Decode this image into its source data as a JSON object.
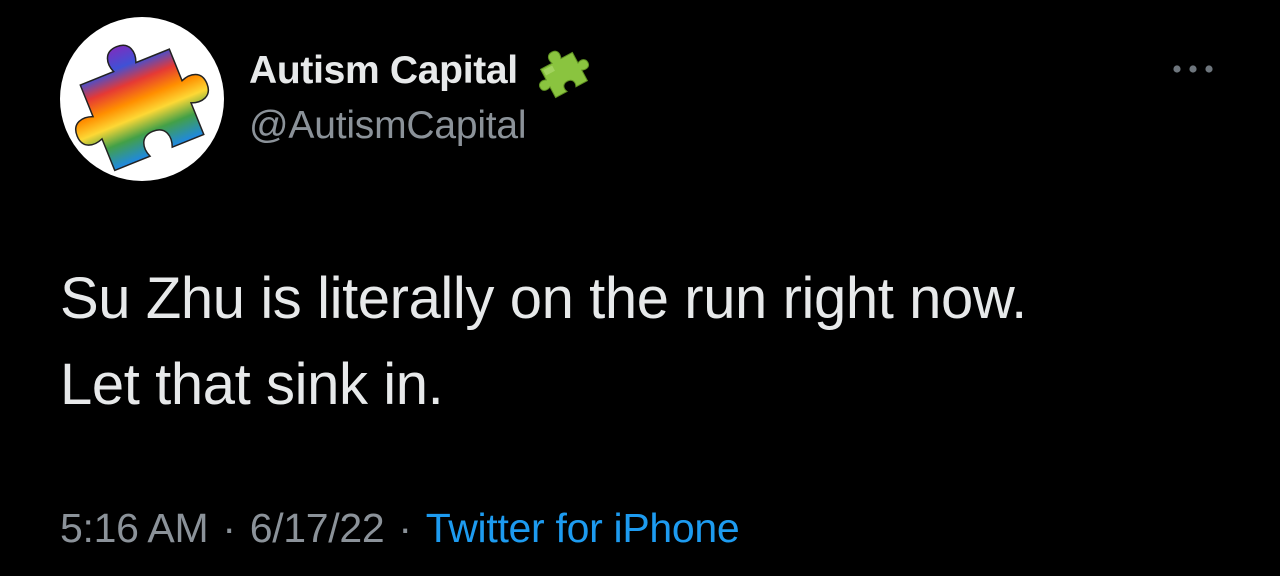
{
  "tweet": {
    "author": {
      "display_name": "Autism Capital",
      "handle": "@AutismCapital",
      "avatar_icon": "rainbow-puzzle-piece-icon",
      "badge_icon": "puzzle-piece-badge-icon"
    },
    "more_icon": "more-options-icon",
    "text_lines": [
      "Su Zhu is literally on the run right now.",
      "Let that sink in."
    ],
    "time": "5:16 AM",
    "separator": "·",
    "date": "6/17/22",
    "source": "Twitter for iPhone"
  },
  "colors": {
    "background": "#000000",
    "primary_text": "#e7e9ea",
    "secondary_text": "#8b9299",
    "link": "#1d9bf0",
    "badge_green": "#8ac43f"
  }
}
